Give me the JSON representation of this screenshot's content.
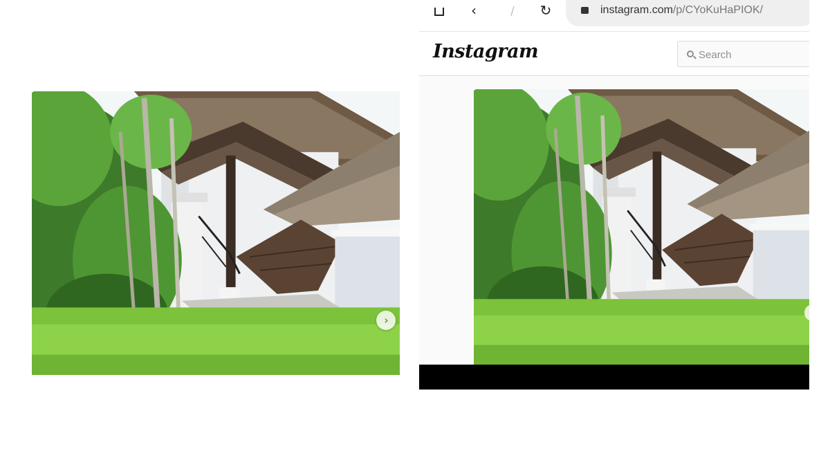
{
  "browser": {
    "url_host": "instagram.com",
    "url_path": "/p/CYoKuHaPIOK/",
    "icons": [
      "home-icon",
      "back-icon",
      "edit-icon",
      "reload-icon",
      "lock-icon"
    ]
  },
  "instagram": {
    "logo": "Instagram",
    "search": {
      "placeholder": "Search",
      "value": ""
    }
  },
  "left_post": {
    "next_button_glyph": "›"
  },
  "colors": {
    "grass": "#7cc23a",
    "thatch": "#8a7762",
    "wall": "#e9ecef",
    "sky": "#f4f7f8",
    "ig_border": "#dbdbdb"
  }
}
